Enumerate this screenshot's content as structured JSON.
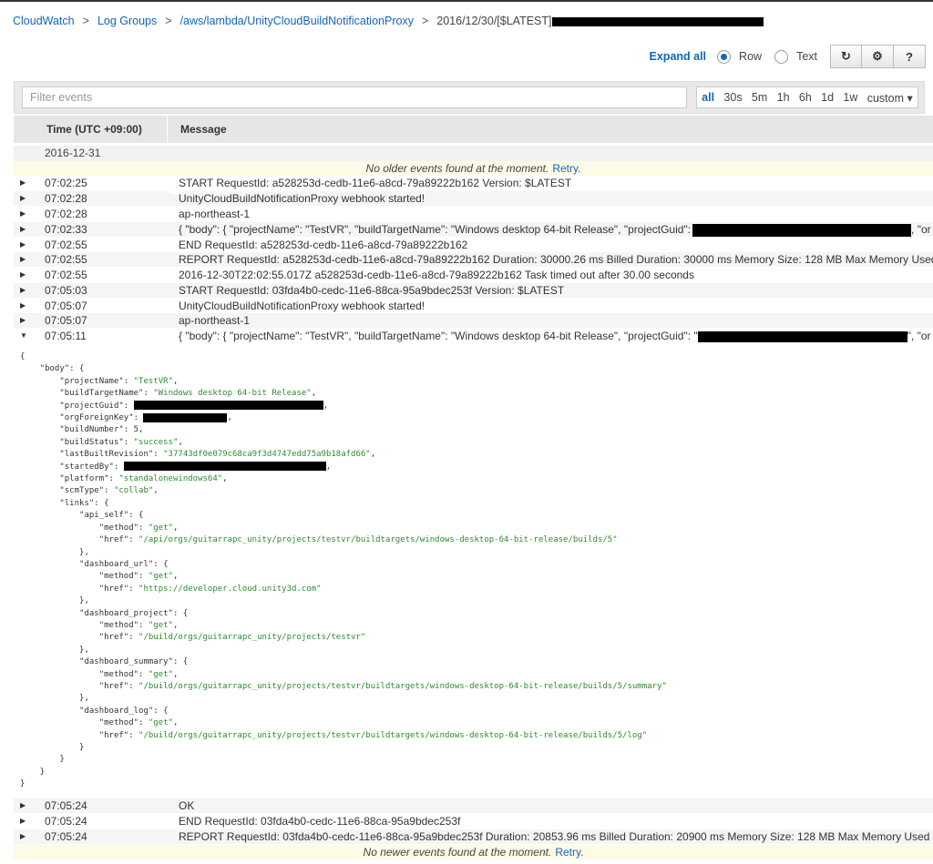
{
  "breadcrumb": {
    "items": [
      "CloudWatch",
      "Log Groups",
      "/aws/lambda/UnityCloudBuildNotificationProxy"
    ],
    "current": "2016/12/30/[$LATEST]",
    "separator": ">"
  },
  "toolbar": {
    "expand_all": "Expand all",
    "view_options": [
      {
        "label": "Row",
        "selected": true
      },
      {
        "label": "Text",
        "selected": false
      }
    ],
    "buttons": [
      {
        "icon": "refresh-icon",
        "glyph": "↻"
      },
      {
        "icon": "gear-icon",
        "glyph": "⚙"
      },
      {
        "icon": "help-icon",
        "glyph": "?"
      }
    ]
  },
  "filter": {
    "placeholder": "Filter events",
    "value": "",
    "ranges": [
      "all",
      "30s",
      "5m",
      "1h",
      "6h",
      "1d",
      "1w",
      "custom ▾"
    ],
    "selected_range": "all"
  },
  "table": {
    "columns": [
      "Time (UTC +09:00)",
      "Message"
    ],
    "date": "2016-12-31",
    "notice_top": {
      "text": "No older events found at the moment.",
      "link": "Retry."
    },
    "notice_bottom": {
      "text": "No newer events found at the moment.",
      "link": "Retry."
    },
    "rows": [
      {
        "time": "07:02:25",
        "msg": "START RequestId: a528253d-cedb-11e6-a8cd-79a89222b162 Version: $LATEST",
        "expanded": false
      },
      {
        "time": "07:02:28",
        "msg": "UnityCloudBuildNotificationProxy webhook started!",
        "expanded": false
      },
      {
        "time": "07:02:28",
        "msg": "ap-northeast-1",
        "expanded": false
      },
      {
        "time": "07:02:33",
        "msg": "{ \"body\": { \"projectName\": \"TestVR\", \"buildTargetName\": \"Windows desktop 64-bit Release\", \"projectGuid\":",
        "msg_tail": ", \"or",
        "expanded": false
      },
      {
        "time": "07:02:55",
        "msg": "END RequestId: a528253d-cedb-11e6-a8cd-79a89222b162",
        "expanded": false
      },
      {
        "time": "07:02:55",
        "msg": "REPORT RequestId: a528253d-cedb-11e6-a8cd-79a89222b162 Duration: 30000.26 ms Billed Duration: 30000 ms Memory Size: 128 MB Max Memory Used",
        "expanded": false
      },
      {
        "time": "07:02:55",
        "msg": "2016-12-30T22:02:55.017Z a528253d-cedb-11e6-a8cd-79a89222b162 Task timed out after 30.00 seconds",
        "expanded": false
      },
      {
        "time": "07:05:03",
        "msg": "START RequestId: 03fda4b0-cedc-11e6-88ca-95a9bdec253f Version: $LATEST",
        "expanded": false
      },
      {
        "time": "07:05:07",
        "msg": "UnityCloudBuildNotificationProxy webhook started!",
        "expanded": false
      },
      {
        "time": "07:05:07",
        "msg": "ap-northeast-1",
        "expanded": false
      },
      {
        "time": "07:05:11",
        "msg": "{ \"body\": { \"projectName\": \"TestVR\", \"buildTargetName\": \"Windows desktop 64-bit Release\", \"projectGuid\": \"",
        "msg_tail": "\", \"or",
        "expanded": true
      }
    ],
    "rows_after": [
      {
        "time": "07:05:24",
        "msg": "OK"
      },
      {
        "time": "07:05:24",
        "msg": "END RequestId: 03fda4b0-cedc-11e6-88ca-95a9bdec253f"
      },
      {
        "time": "07:05:24",
        "msg": "REPORT RequestId: 03fda4b0-cedc-11e6-88ca-95a9bdec253f Duration: 20853.96 ms Billed Duration: 20900 ms Memory Size: 128 MB Max Memory Used"
      }
    ]
  },
  "json_detail": {
    "projectName": "\"TestVR\"",
    "buildTargetName": "\"Windows desktop 64-bit Release\"",
    "buildNumber": "5",
    "buildStatus": "\"success\"",
    "lastBuiltRevision": "\"37743df0e079c68ca9f3d4747edd75a9b18afd66\"",
    "platform": "\"standalonewindows64\"",
    "scmType": "\"collab\"",
    "method": "\"get\"",
    "api_self_href": "\"/api/orgs/guitarrapc_unity/projects/testvr/buildtargets/windows-desktop-64-bit-release/builds/5\"",
    "dashboard_url_href": "\"https://developer.cloud.unity3d.com\"",
    "dashboard_project_href": "\"/build/orgs/guitarrapc_unity/projects/testvr\"",
    "dashboard_summary_href": "\"/build/orgs/guitarrapc_unity/projects/testvr/buildtargets/windows-desktop-64-bit-release/builds/5/summary\"",
    "dashboard_log_href": "\"/build/orgs/guitarrapc_unity/projects/testvr/buildtargets/windows-desktop-64-bit-release/builds/5/log\""
  }
}
